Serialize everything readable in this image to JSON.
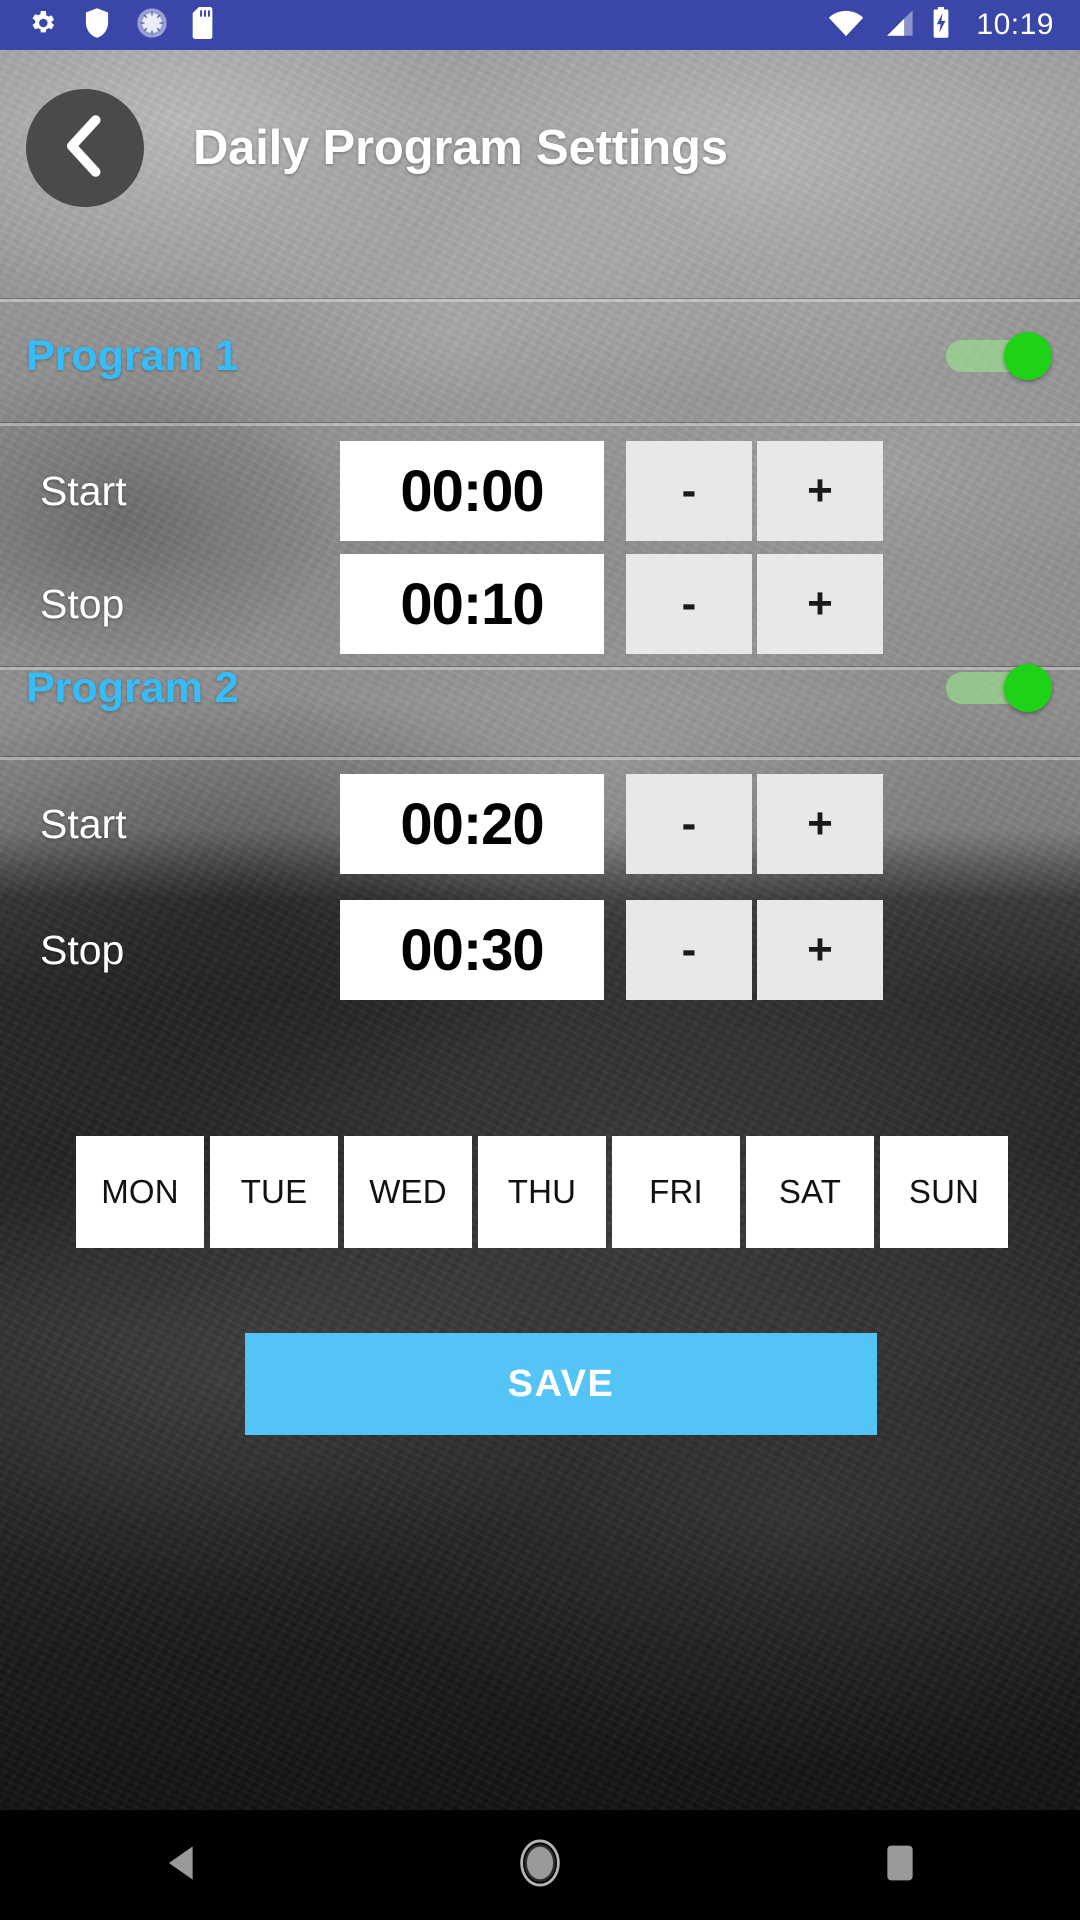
{
  "status_bar": {
    "background_color": "#3A46A8",
    "time": "10:19",
    "left_icons": [
      "gear-icon",
      "shield-icon",
      "sync-circle-icon",
      "sd-card-icon"
    ],
    "right_icons": [
      "wifi-icon",
      "cellular-signal-icon",
      "battery-charging-icon"
    ]
  },
  "header": {
    "back_icon": "chevron-left-icon",
    "title": "Daily Program Settings"
  },
  "colors": {
    "program_label": "#35BDFA",
    "toggle_on": "#1FD117",
    "save_button": "#54C4F7",
    "step_button": "#E8E8E8"
  },
  "programs": [
    {
      "label": "Program 1",
      "enabled": true,
      "toggle_state": "on",
      "rows": [
        {
          "label": "Start",
          "value": "00:00",
          "minus": "-",
          "plus": "+"
        },
        {
          "label": "Stop",
          "value": "00:10",
          "minus": "-",
          "plus": "+"
        }
      ]
    },
    {
      "label": "Program 2",
      "enabled": true,
      "toggle_state": "on",
      "rows": [
        {
          "label": "Start",
          "value": "00:20",
          "minus": "-",
          "plus": "+"
        },
        {
          "label": "Stop",
          "value": "00:30",
          "minus": "-",
          "plus": "+"
        }
      ]
    }
  ],
  "days": [
    {
      "label": "MON",
      "selected": false
    },
    {
      "label": "TUE",
      "selected": false
    },
    {
      "label": "WED",
      "selected": false
    },
    {
      "label": "THU",
      "selected": false
    },
    {
      "label": "FRI",
      "selected": false
    },
    {
      "label": "SAT",
      "selected": false
    },
    {
      "label": "SUN",
      "selected": false
    }
  ],
  "save_button": {
    "label": "SAVE"
  },
  "nav_bar": {
    "items": [
      "back-triangle-icon",
      "home-circle-icon",
      "recents-square-icon"
    ]
  }
}
